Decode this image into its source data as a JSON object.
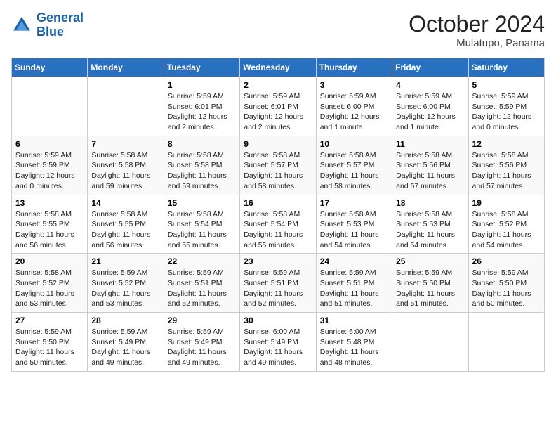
{
  "header": {
    "logo_line1": "General",
    "logo_line2": "Blue",
    "month": "October 2024",
    "location": "Mulatupo, Panama"
  },
  "weekdays": [
    "Sunday",
    "Monday",
    "Tuesday",
    "Wednesday",
    "Thursday",
    "Friday",
    "Saturday"
  ],
  "weeks": [
    [
      {
        "day": "",
        "info": ""
      },
      {
        "day": "",
        "info": ""
      },
      {
        "day": "1",
        "info": "Sunrise: 5:59 AM\nSunset: 6:01 PM\nDaylight: 12 hours\nand 2 minutes."
      },
      {
        "day": "2",
        "info": "Sunrise: 5:59 AM\nSunset: 6:01 PM\nDaylight: 12 hours\nand 2 minutes."
      },
      {
        "day": "3",
        "info": "Sunrise: 5:59 AM\nSunset: 6:00 PM\nDaylight: 12 hours\nand 1 minute."
      },
      {
        "day": "4",
        "info": "Sunrise: 5:59 AM\nSunset: 6:00 PM\nDaylight: 12 hours\nand 1 minute."
      },
      {
        "day": "5",
        "info": "Sunrise: 5:59 AM\nSunset: 5:59 PM\nDaylight: 12 hours\nand 0 minutes."
      }
    ],
    [
      {
        "day": "6",
        "info": "Sunrise: 5:59 AM\nSunset: 5:59 PM\nDaylight: 12 hours\nand 0 minutes."
      },
      {
        "day": "7",
        "info": "Sunrise: 5:58 AM\nSunset: 5:58 PM\nDaylight: 11 hours\nand 59 minutes."
      },
      {
        "day": "8",
        "info": "Sunrise: 5:58 AM\nSunset: 5:58 PM\nDaylight: 11 hours\nand 59 minutes."
      },
      {
        "day": "9",
        "info": "Sunrise: 5:58 AM\nSunset: 5:57 PM\nDaylight: 11 hours\nand 58 minutes."
      },
      {
        "day": "10",
        "info": "Sunrise: 5:58 AM\nSunset: 5:57 PM\nDaylight: 11 hours\nand 58 minutes."
      },
      {
        "day": "11",
        "info": "Sunrise: 5:58 AM\nSunset: 5:56 PM\nDaylight: 11 hours\nand 57 minutes."
      },
      {
        "day": "12",
        "info": "Sunrise: 5:58 AM\nSunset: 5:56 PM\nDaylight: 11 hours\nand 57 minutes."
      }
    ],
    [
      {
        "day": "13",
        "info": "Sunrise: 5:58 AM\nSunset: 5:55 PM\nDaylight: 11 hours\nand 56 minutes."
      },
      {
        "day": "14",
        "info": "Sunrise: 5:58 AM\nSunset: 5:55 PM\nDaylight: 11 hours\nand 56 minutes."
      },
      {
        "day": "15",
        "info": "Sunrise: 5:58 AM\nSunset: 5:54 PM\nDaylight: 11 hours\nand 55 minutes."
      },
      {
        "day": "16",
        "info": "Sunrise: 5:58 AM\nSunset: 5:54 PM\nDaylight: 11 hours\nand 55 minutes."
      },
      {
        "day": "17",
        "info": "Sunrise: 5:58 AM\nSunset: 5:53 PM\nDaylight: 11 hours\nand 54 minutes."
      },
      {
        "day": "18",
        "info": "Sunrise: 5:58 AM\nSunset: 5:53 PM\nDaylight: 11 hours\nand 54 minutes."
      },
      {
        "day": "19",
        "info": "Sunrise: 5:58 AM\nSunset: 5:52 PM\nDaylight: 11 hours\nand 54 minutes."
      }
    ],
    [
      {
        "day": "20",
        "info": "Sunrise: 5:58 AM\nSunset: 5:52 PM\nDaylight: 11 hours\nand 53 minutes."
      },
      {
        "day": "21",
        "info": "Sunrise: 5:59 AM\nSunset: 5:52 PM\nDaylight: 11 hours\nand 53 minutes."
      },
      {
        "day": "22",
        "info": "Sunrise: 5:59 AM\nSunset: 5:51 PM\nDaylight: 11 hours\nand 52 minutes."
      },
      {
        "day": "23",
        "info": "Sunrise: 5:59 AM\nSunset: 5:51 PM\nDaylight: 11 hours\nand 52 minutes."
      },
      {
        "day": "24",
        "info": "Sunrise: 5:59 AM\nSunset: 5:51 PM\nDaylight: 11 hours\nand 51 minutes."
      },
      {
        "day": "25",
        "info": "Sunrise: 5:59 AM\nSunset: 5:50 PM\nDaylight: 11 hours\nand 51 minutes."
      },
      {
        "day": "26",
        "info": "Sunrise: 5:59 AM\nSunset: 5:50 PM\nDaylight: 11 hours\nand 50 minutes."
      }
    ],
    [
      {
        "day": "27",
        "info": "Sunrise: 5:59 AM\nSunset: 5:50 PM\nDaylight: 11 hours\nand 50 minutes."
      },
      {
        "day": "28",
        "info": "Sunrise: 5:59 AM\nSunset: 5:49 PM\nDaylight: 11 hours\nand 49 minutes."
      },
      {
        "day": "29",
        "info": "Sunrise: 5:59 AM\nSunset: 5:49 PM\nDaylight: 11 hours\nand 49 minutes."
      },
      {
        "day": "30",
        "info": "Sunrise: 6:00 AM\nSunset: 5:49 PM\nDaylight: 11 hours\nand 49 minutes."
      },
      {
        "day": "31",
        "info": "Sunrise: 6:00 AM\nSunset: 5:48 PM\nDaylight: 11 hours\nand 48 minutes."
      },
      {
        "day": "",
        "info": ""
      },
      {
        "day": "",
        "info": ""
      }
    ]
  ]
}
